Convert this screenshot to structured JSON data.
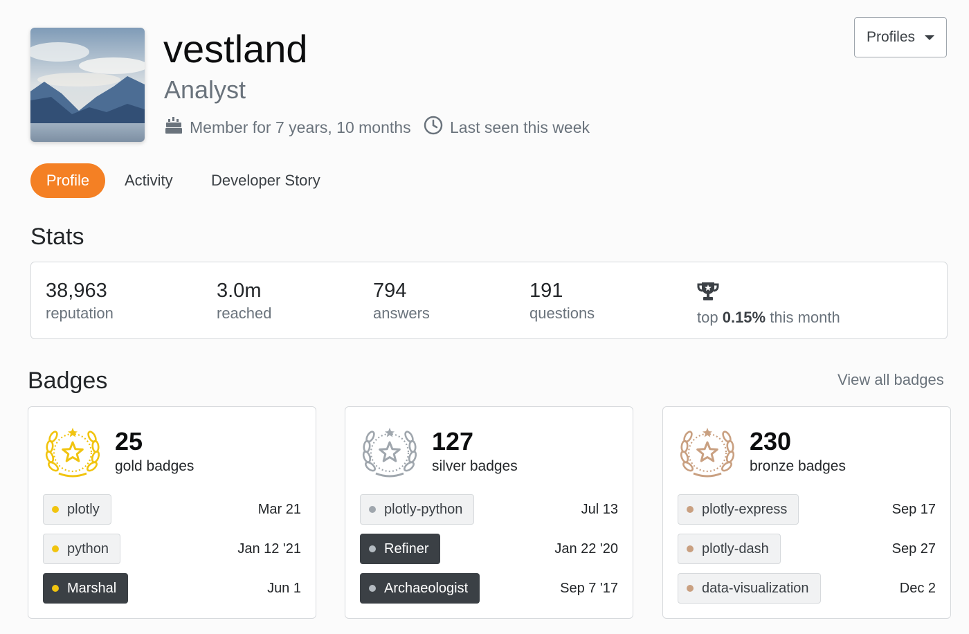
{
  "header": {
    "username": "vestland",
    "role": "Analyst",
    "member_for": "Member for 7 years, 10 months",
    "last_seen": "Last seen this week",
    "profiles_button": "Profiles"
  },
  "tabs": [
    {
      "label": "Profile",
      "active": true
    },
    {
      "label": "Activity",
      "active": false
    },
    {
      "label": "Developer Story",
      "active": false
    }
  ],
  "stats": {
    "heading": "Stats",
    "items": [
      {
        "value": "38,963",
        "label": "reputation"
      },
      {
        "value": "3.0m",
        "label": "reached"
      },
      {
        "value": "794",
        "label": "answers"
      },
      {
        "value": "191",
        "label": "questions"
      }
    ],
    "top": {
      "prefix": "top",
      "value": "0.15%",
      "suffix": "this month"
    }
  },
  "badges": {
    "heading": "Badges",
    "view_all": "View all badges",
    "colors": {
      "gold": "#f1c40f",
      "silver": "#9fa6ad",
      "bronze": "#c9a081"
    },
    "cards": [
      {
        "count": "25",
        "label": "gold badges",
        "items": [
          {
            "name": "plotly",
            "date": "Mar 21",
            "dark": false
          },
          {
            "name": "python",
            "date": "Jan 12 '21",
            "dark": false
          },
          {
            "name": "Marshal",
            "date": "Jun 1",
            "dark": true
          }
        ]
      },
      {
        "count": "127",
        "label": "silver badges",
        "items": [
          {
            "name": "plotly-python",
            "date": "Jul 13",
            "dark": false
          },
          {
            "name": "Refiner",
            "date": "Jan 22 '20",
            "dark": true
          },
          {
            "name": "Archaeologist",
            "date": "Sep 7 '17",
            "dark": true
          }
        ]
      },
      {
        "count": "230",
        "label": "bronze badges",
        "items": [
          {
            "name": "plotly-express",
            "date": "Sep 17",
            "dark": false
          },
          {
            "name": "plotly-dash",
            "date": "Sep 27",
            "dark": false
          },
          {
            "name": "data-visualization",
            "date": "Dec 2",
            "dark": false
          }
        ]
      }
    ]
  },
  "accent": "#f48024"
}
